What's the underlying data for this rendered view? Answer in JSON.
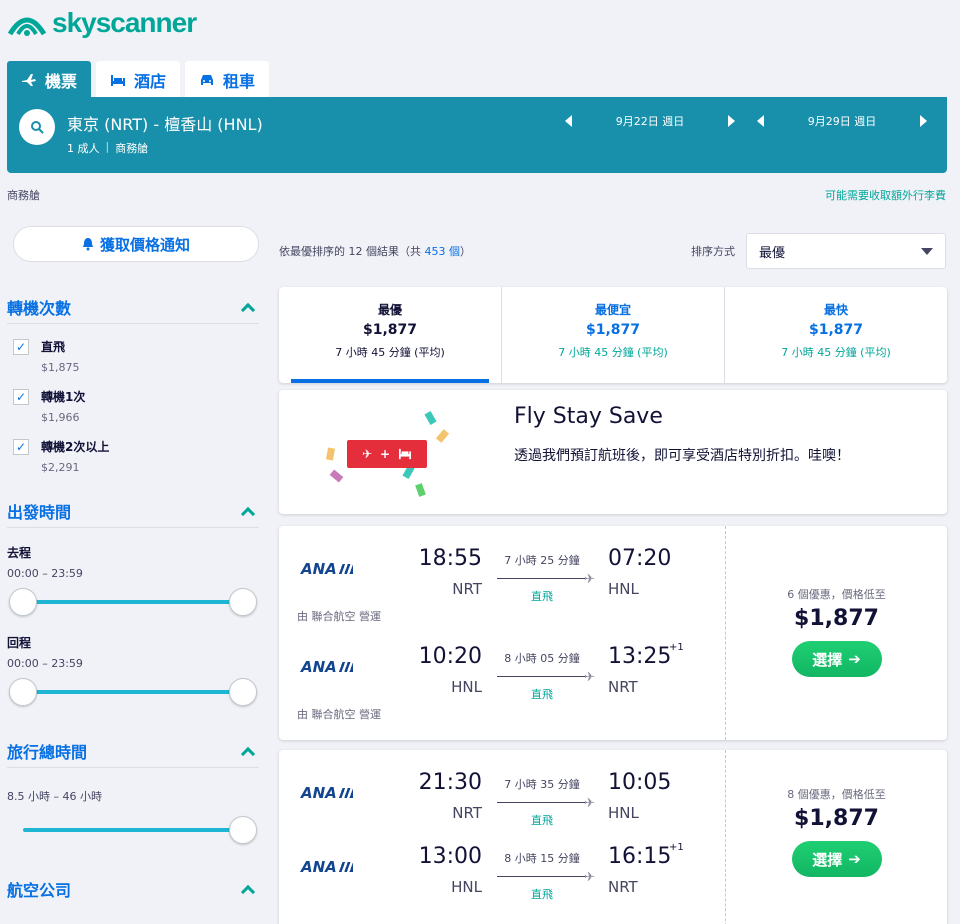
{
  "brand": {
    "name": "skyscanner",
    "color": "#00a698"
  },
  "tabs": [
    {
      "label": "機票",
      "icon": "plane-icon",
      "active": true
    },
    {
      "label": "酒店",
      "icon": "bed-icon",
      "active": false
    },
    {
      "label": "租車",
      "icon": "car-icon",
      "active": false
    }
  ],
  "search": {
    "route": "東京 (NRT) - 檀香山 (HNL)",
    "passengers": "1 成人",
    "cabin": "商務艙",
    "depart_date": "9月22日 週日",
    "return_date": "9月29日 週日"
  },
  "cabin_label": "商務艙",
  "baggage_note": "可能需要收取額外行李費",
  "sidebar": {
    "alert_label": "獲取價格通知",
    "stops_title": "轉機次數",
    "stops": [
      {
        "label": "直飛",
        "price": "$1,875",
        "checked": true
      },
      {
        "label": "轉機1次",
        "price": "$1,966",
        "checked": true
      },
      {
        "label": "轉機2次以上",
        "price": "$2,291",
        "checked": true
      }
    ],
    "times_title": "出發時間",
    "outbound_label": "去程",
    "outbound_range": "00:00 – 23:59",
    "return_label": "回程",
    "return_range": "00:00 – 23:59",
    "duration_title": "旅行總時間",
    "duration_range": "8.5 小時 – 46 小時",
    "airlines_title": "航空公司"
  },
  "results": {
    "count_prefix": "依最優排序的 12 個結果（共 ",
    "total": "453 個",
    "count_suffix": "）",
    "sort_label": "排序方式",
    "sort_value": "最優"
  },
  "sort_tabs": [
    {
      "title": "最優",
      "price": "$1,877",
      "duration": "7 小時 45 分鐘 (平均)"
    },
    {
      "title": "最便宜",
      "price": "$1,877",
      "duration": "7 小時 45 分鐘 (平均)"
    },
    {
      "title": "最快",
      "price": "$1,877",
      "duration": "7 小時 45 分鐘 (平均)"
    }
  ],
  "promo": {
    "title": "Fly Stay Save",
    "text": "透過我們預訂航班後，即可享受酒店特別折扣。哇噢！",
    "badge_plus": "+"
  },
  "flights": [
    {
      "deals": "6 個優惠，價格低至",
      "price": "$1,877",
      "button": "選擇",
      "legs": [
        {
          "airline": "ANA",
          "dep_time": "18:55",
          "dep_code": "NRT",
          "duration": "7 小時 25 分鐘",
          "stops": "直飛",
          "arr_time": "07:20",
          "arr_code": "HNL",
          "plus": "",
          "operated": "由 聯合航空 營運"
        },
        {
          "airline": "ANA",
          "dep_time": "10:20",
          "dep_code": "HNL",
          "duration": "8 小時 05 分鐘",
          "stops": "直飛",
          "arr_time": "13:25",
          "arr_code": "NRT",
          "plus": "+1",
          "operated": "由 聯合航空 營運"
        }
      ]
    },
    {
      "deals": "8 個優惠，價格低至",
      "price": "$1,877",
      "button": "選擇",
      "legs": [
        {
          "airline": "ANA",
          "dep_time": "21:30",
          "dep_code": "NRT",
          "duration": "7 小時 35 分鐘",
          "stops": "直飛",
          "arr_time": "10:05",
          "arr_code": "HNL",
          "plus": ""
        },
        {
          "airline": "ANA",
          "dep_time": "13:00",
          "dep_code": "HNL",
          "duration": "8 小時 15 分鐘",
          "stops": "直飛",
          "arr_time": "16:15",
          "arr_code": "NRT",
          "plus": "+1"
        }
      ]
    }
  ]
}
